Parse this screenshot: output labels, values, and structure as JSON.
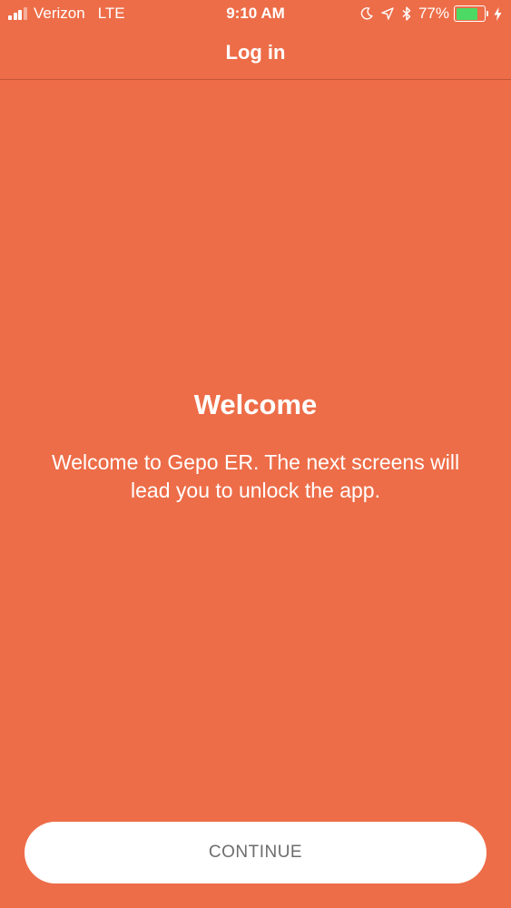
{
  "status_bar": {
    "carrier": "Verizon",
    "network": "LTE",
    "time": "9:10 AM",
    "battery_percent": "77%",
    "battery_level": 0.77,
    "signal_bars_filled": 3,
    "signal_bars_total": 4,
    "icons": [
      "moon-icon",
      "location-arrow-icon",
      "bluetooth-icon",
      "charging-bolt-icon"
    ],
    "battery_fill_color": "#4CD964"
  },
  "nav": {
    "title": "Log in"
  },
  "main": {
    "title": "Welcome",
    "body": "Welcome to Gepo ER. The next screens will lead you to unlock the app."
  },
  "footer": {
    "continue_label": "CONTINUE"
  },
  "colors": {
    "background": "#ED6D48",
    "text": "#FFFFFF",
    "button_bg": "#FFFFFF",
    "button_text": "#6D6D6D"
  }
}
